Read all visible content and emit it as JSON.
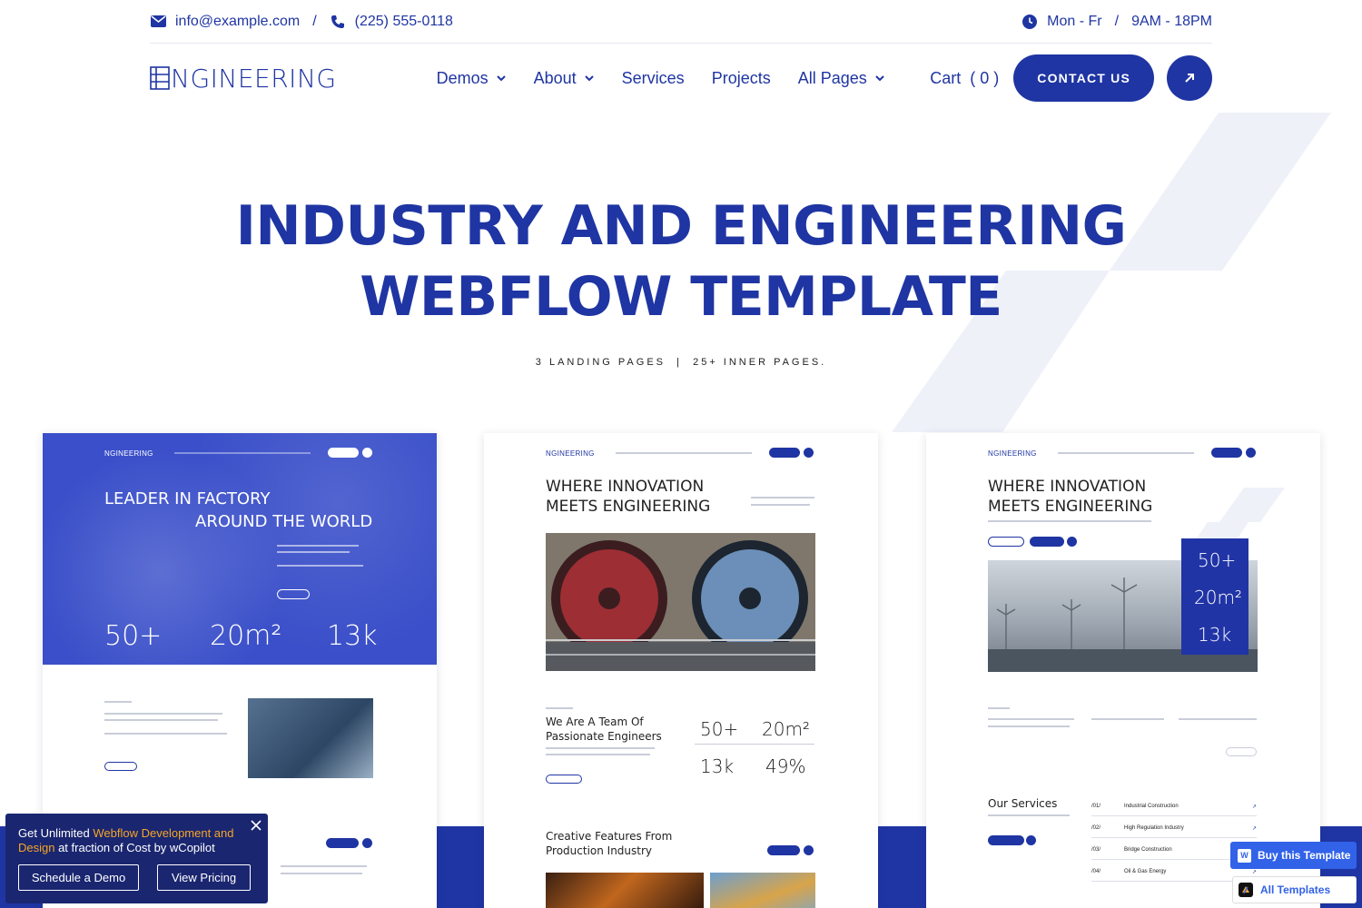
{
  "topbar": {
    "email": "info@example.com",
    "phone": "(225) 555-0118",
    "hours_days": "Mon - Fr",
    "hours_time": "9AM - 18PM",
    "separator": "/"
  },
  "nav": {
    "logo": "NGINEERING",
    "items": [
      {
        "label": "Demos",
        "dropdown": true
      },
      {
        "label": "About",
        "dropdown": true
      },
      {
        "label": "Services",
        "dropdown": false
      },
      {
        "label": "Projects",
        "dropdown": false
      },
      {
        "label": "All Pages",
        "dropdown": true
      }
    ],
    "cart_label": "Cart",
    "cart_count": "( 0 )",
    "cta_label": "CONTACT US"
  },
  "hero": {
    "title_line1": "INDUSTRY AND ENGINEERING",
    "title_line2": "WEBFLOW TEMPLATE",
    "subtitle": "3 LANDING PAGES  |  25+ INNER PAGES."
  },
  "previews": {
    "p1": {
      "logo": "NGINEERING",
      "heading_line1": "LEADER IN FACTORY",
      "heading_line2": "AROUND THE WORLD",
      "stats": [
        "50+",
        "20m²",
        "13k"
      ]
    },
    "p2": {
      "logo": "NGINEERING",
      "heading_line1": "WHERE INNOVATION",
      "heading_line2": "MEETS ENGINEERING",
      "team_line1": "We Are A Team Of",
      "team_line2": "Passionate Engineers",
      "stats": [
        "50+",
        "20m²",
        "13k",
        "49%"
      ],
      "features_line1": "Creative Features From",
      "features_line2": "Production Industry"
    },
    "p3": {
      "logo": "NGINEERING",
      "heading_line1": "WHERE INNOVATION",
      "heading_line2": "MEETS ENGINEERING",
      "stats": [
        "50+",
        "20m²",
        "13k"
      ],
      "services_title": "Our Services",
      "services": [
        {
          "num": "/01/",
          "name": "Industrial Construction"
        },
        {
          "num": "/02/",
          "name": "High Regulation Industry"
        },
        {
          "num": "/03/",
          "name": "Bridge Construction"
        },
        {
          "num": "/04/",
          "name": "Oil & Gas Energy"
        }
      ]
    }
  },
  "promo": {
    "text_before": "Get Unlimited ",
    "text_highlight": "Webflow Development and Design",
    "text_after": " at fraction of Cost by wCopilot",
    "btn_demo": "Schedule a Demo",
    "btn_pricing": "View Pricing"
  },
  "floating": {
    "buy_label": "Buy this Template",
    "all_label": "All Templates"
  },
  "colors": {
    "primary": "#1f35a3",
    "accent": "#f5a524",
    "webflow_blue": "#3262e8",
    "promo_bg": "#1a2670"
  },
  "icons": [
    "envelope-icon",
    "phone-icon",
    "clock-icon",
    "chevron-down-icon",
    "arrow-up-right-icon",
    "close-icon",
    "webflow-icon"
  ]
}
